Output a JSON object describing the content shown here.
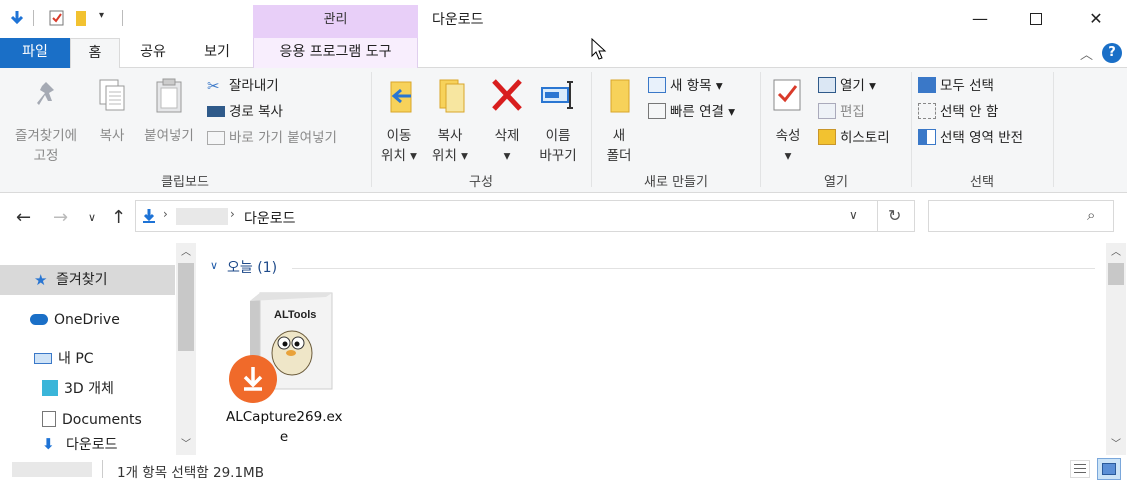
{
  "window": {
    "title": "다운로드",
    "context_tab_label": "관리"
  },
  "tabs": {
    "file": "파일",
    "home": "홈",
    "share": "공유",
    "view": "보기",
    "app_tools": "응용 프로그램 도구"
  },
  "ribbon": {
    "clipboard": {
      "label": "클립보드",
      "pin": [
        "즐겨찾기에",
        "고정"
      ],
      "copy": "복사",
      "paste": "붙여넣기",
      "cut": "잘라내기",
      "copy_path": "경로 복사",
      "paste_shortcut": "바로 가기 붙여넣기"
    },
    "organize": {
      "label": "구성",
      "move_to": [
        "이동",
        "위치"
      ],
      "copy_to": [
        "복사",
        "위치"
      ],
      "delete": "삭제",
      "rename": [
        "이름",
        "바꾸기"
      ]
    },
    "new": {
      "label": "새로 만들기",
      "new_folder": [
        "새",
        "폴더"
      ],
      "new_item": "새 항목",
      "easy_access": "빠른 연결"
    },
    "open": {
      "label": "열기",
      "properties": "속성",
      "open": "열기",
      "edit": "편집",
      "history": "히스토리"
    },
    "select": {
      "label": "선택",
      "select_all": "모두 선택",
      "select_none": "선택 안 함",
      "invert": "선택 영역 반전"
    }
  },
  "address": {
    "path_current": "다운로드"
  },
  "nav": {
    "items": [
      {
        "label": "즐겨찾기",
        "icon": "star-icon"
      },
      {
        "label": "OneDrive",
        "icon": "cloud-icon"
      },
      {
        "label": "내 PC",
        "icon": "computer-icon"
      },
      {
        "label": "3D 개체",
        "icon": "cube-icon"
      },
      {
        "label": "Documents",
        "icon": "document-icon"
      },
      {
        "label": "다운로드",
        "icon": "download-arrow-icon"
      }
    ]
  },
  "content": {
    "group_header": "오늘 (1)",
    "file": {
      "name_line1": "ALCapture269.ex",
      "name_line2": "e",
      "box_brand": "ALTools"
    }
  },
  "status": {
    "text": "1개 항목 선택함 29.1MB"
  },
  "colors": {
    "accent": "#1a6fc7",
    "context_tab": "#e8cff8",
    "badge": "#f06a2a"
  }
}
